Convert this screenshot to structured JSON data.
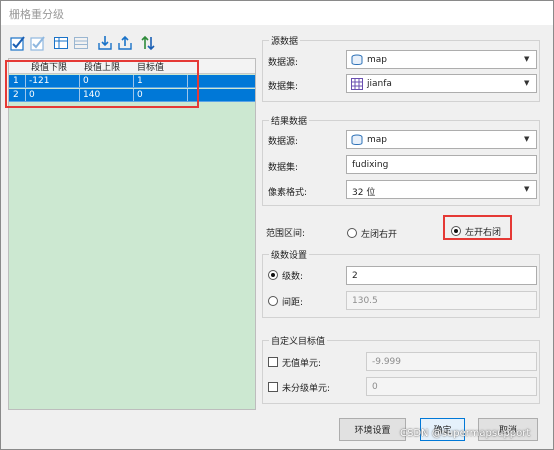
{
  "window": {
    "title": "栅格重分级"
  },
  "toolbar": {
    "icons": [
      "select-all-icon",
      "select-inverse-icon",
      "insert-row-icon",
      "delete-row-icon",
      "import-icon",
      "export-icon",
      "sort-icon"
    ]
  },
  "table": {
    "headers": [
      "段值下限",
      "段值上限",
      "目标值"
    ],
    "rows": [
      {
        "index": "1",
        "lower": "-121",
        "upper": "0",
        "target": "1"
      },
      {
        "index": "2",
        "lower": "0",
        "upper": "140",
        "target": "0"
      }
    ]
  },
  "source": {
    "title": "源数据",
    "datasource_label": "数据源:",
    "datasource_value": "map",
    "dataset_label": "数据集:",
    "dataset_value": "jianfa"
  },
  "result": {
    "title": "结果数据",
    "datasource_label": "数据源:",
    "datasource_value": "map",
    "dataset_label": "数据集:",
    "dataset_value": "fudixing",
    "pixel_label": "像素格式:",
    "pixel_value": "32 位"
  },
  "range": {
    "label": "范围区间:",
    "option_left": "左闭右开",
    "option_right": "左开右闭",
    "selected": "左开右闭"
  },
  "levels": {
    "title": "级数设置",
    "count_label": "级数:",
    "count_value": "2",
    "interval_label": "间距:",
    "interval_value": "130.5"
  },
  "custom": {
    "title": "自定义目标值",
    "nodata_label": "无值单元:",
    "nodata_value": "-9.999",
    "unclassified_label": "未分级单元:",
    "unclassified_value": "0"
  },
  "buttons": {
    "env": "环境设置",
    "ok": "确定",
    "cancel": "取消"
  },
  "watermark": "CSDN @supermapsupport"
}
